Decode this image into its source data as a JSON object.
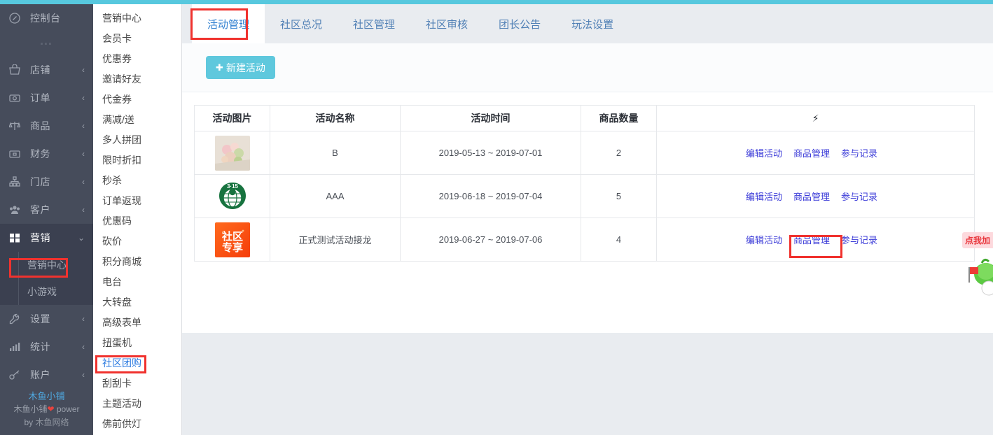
{
  "theme": {
    "top_strip": "#57c8de",
    "sidebar_bg": "#464c5b",
    "sidebar_active_bg": "#3b4050",
    "accent_cyan": "#5fc8dd",
    "link_blue": "#3b3bd8",
    "tab_blue": "#2f7fd0",
    "annotation_red": "#f0322e",
    "main_bg": "#e9ecf0"
  },
  "sidebar": {
    "items": [
      {
        "label": "控制台",
        "icon": "dashboard-icon",
        "arrow": "",
        "active": false
      },
      {
        "label": "店铺",
        "icon": "shop-basket-icon",
        "arrow": "‹",
        "active": false
      },
      {
        "label": "订单",
        "icon": "order-icon",
        "arrow": "‹",
        "active": false
      },
      {
        "label": "商品",
        "icon": "goods-scale-icon",
        "arrow": "‹",
        "active": false
      },
      {
        "label": "财务",
        "icon": "finance-money-icon",
        "arrow": "‹",
        "active": false
      },
      {
        "label": "门店",
        "icon": "store-sitemap-icon",
        "arrow": "‹",
        "active": false
      },
      {
        "label": "客户",
        "icon": "customer-users-icon",
        "arrow": "‹",
        "active": false
      },
      {
        "label": "营销",
        "icon": "marketing-gift-icon",
        "arrow": "⌄",
        "active": true
      },
      {
        "label": "设置",
        "icon": "settings-wrench-icon",
        "arrow": "‹",
        "active": false
      },
      {
        "label": "统计",
        "icon": "statistics-bars-icon",
        "arrow": "‹",
        "active": false
      },
      {
        "label": "账户",
        "icon": "account-key-icon",
        "arrow": "‹",
        "active": false
      }
    ],
    "submenu": [
      {
        "label": "营销中心",
        "highlighted": true
      },
      {
        "label": "小游戏",
        "highlighted": false
      }
    ],
    "footer": {
      "shop_name": "木鱼小铺",
      "powered_prefix": "木鱼小铺",
      "powered_heart": "❤",
      "powered_middle": " power",
      "powered_by": "by ",
      "powered_network": "木鱼网络"
    }
  },
  "subnav": {
    "items": [
      {
        "label": "营销中心",
        "active": false
      },
      {
        "label": "会员卡",
        "active": false
      },
      {
        "label": "优惠券",
        "active": false
      },
      {
        "label": "邀请好友",
        "active": false
      },
      {
        "label": "代金券",
        "active": false
      },
      {
        "label": "满减/送",
        "active": false
      },
      {
        "label": "多人拼团",
        "active": false
      },
      {
        "label": "限时折扣",
        "active": false
      },
      {
        "label": "秒杀",
        "active": false
      },
      {
        "label": "订单返现",
        "active": false
      },
      {
        "label": "优惠码",
        "active": false
      },
      {
        "label": "砍价",
        "active": false
      },
      {
        "label": "积分商城",
        "active": false
      },
      {
        "label": "电台",
        "active": false
      },
      {
        "label": "大转盘",
        "active": false
      },
      {
        "label": "高级表单",
        "active": false
      },
      {
        "label": "扭蛋机",
        "active": false
      },
      {
        "label": "社区团购",
        "active": true
      },
      {
        "label": "刮刮卡",
        "active": false
      },
      {
        "label": "主题活动",
        "active": false
      },
      {
        "label": "佛前供灯",
        "active": false
      }
    ]
  },
  "tabs": [
    {
      "label": "活动管理",
      "active": true
    },
    {
      "label": "社区总况",
      "active": false
    },
    {
      "label": "社区管理",
      "active": false
    },
    {
      "label": "社区审核",
      "active": false
    },
    {
      "label": "团长公告",
      "active": false
    },
    {
      "label": "玩法设置",
      "active": false
    }
  ],
  "toolbar": {
    "new_activity_plus": "✚",
    "new_activity_label": "新建活动"
  },
  "table": {
    "headers": {
      "image": "活动图片",
      "name": "活动名称",
      "time": "活动时间",
      "quantity": "商品数量",
      "operations": "⚡"
    },
    "rows": [
      {
        "image": "flowers-photo-thumbnail",
        "name": "B",
        "time": "2019-05-13 ~ 2019-07-01",
        "quantity": "2",
        "ops": [
          "编辑活动",
          "商品管理",
          "参与记录"
        ]
      },
      {
        "image": "315-logo-thumbnail",
        "name": "AAA",
        "time": "2019-06-18 ~ 2019-07-04",
        "quantity": "5",
        "ops": [
          "编辑活动",
          "商品管理",
          "参与记录"
        ]
      },
      {
        "image": "community-exclusive-banner-thumbnail",
        "name": "正式测试活动接龙",
        "time": "2019-06-27 ~ 2019-07-06",
        "quantity": "4",
        "ops": [
          "编辑活动",
          "商品管理",
          "参与记录"
        ]
      }
    ]
  },
  "mascot": {
    "bubble_text": "点我加"
  }
}
